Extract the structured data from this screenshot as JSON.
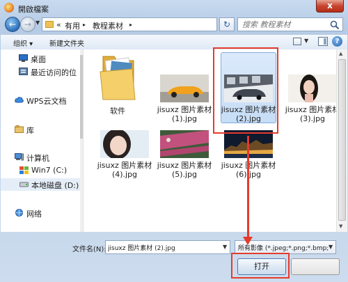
{
  "window": {
    "title": "開啟檔案",
    "close_label": "x"
  },
  "nav": {
    "back_glyph": "←",
    "forward_glyph": "→",
    "refresh_glyph": "↻"
  },
  "address": {
    "overflow": "«",
    "crumbs": [
      "有用",
      "教程素材"
    ],
    "separator": "▸"
  },
  "search": {
    "placeholder": "搜索 教程素材"
  },
  "toolbar": {
    "organize": "组织 ▾",
    "new_folder": "新建文件夹",
    "help": "?"
  },
  "sidebar": {
    "items": [
      {
        "label": "桌面",
        "icon": "desktop-icon"
      },
      {
        "label": "最近访问的位",
        "icon": "recent-places-icon"
      },
      {
        "label": "WPS云文档",
        "icon": "cloud-icon"
      },
      {
        "label": "库",
        "icon": "library-icon"
      },
      {
        "label": "计算机",
        "icon": "computer-icon"
      },
      {
        "label": "Win7 (C:)",
        "icon": "windows-drive-icon"
      },
      {
        "label": "本地磁盘 (D:)",
        "icon": "local-disk-icon"
      },
      {
        "label": "网络",
        "icon": "network-icon"
      }
    ]
  },
  "files": [
    {
      "label": "软件",
      "kind": "folder"
    },
    {
      "label": "jisuxz 图片素材 (1).jpg",
      "kind": "car-yellow"
    },
    {
      "label": "jisuxz 图片素材 (2).jpg",
      "kind": "car-showroom"
    },
    {
      "label": "jisuxz 图片素材 (3).jpg",
      "kind": "woman-portrait"
    },
    {
      "label": "jisuxz 图片素材 (4).jpg",
      "kind": "woman-closeup"
    },
    {
      "label": "jisuxz 图片素材 (5).jpg",
      "kind": "flower-field"
    },
    {
      "label": "jisuxz 图片素材 (6).jpg",
      "kind": "night-city"
    }
  ],
  "footer": {
    "filename_label": "文件名(N):",
    "filename_value": "jisuxz 图片素材 (2).jpg",
    "filetype_value": "所有影像 (*.jpeg;*.png;*.bmp;",
    "open_label": "打开"
  },
  "colors": {
    "highlight": "#e53b2c",
    "selection": "#c6ddf6"
  }
}
